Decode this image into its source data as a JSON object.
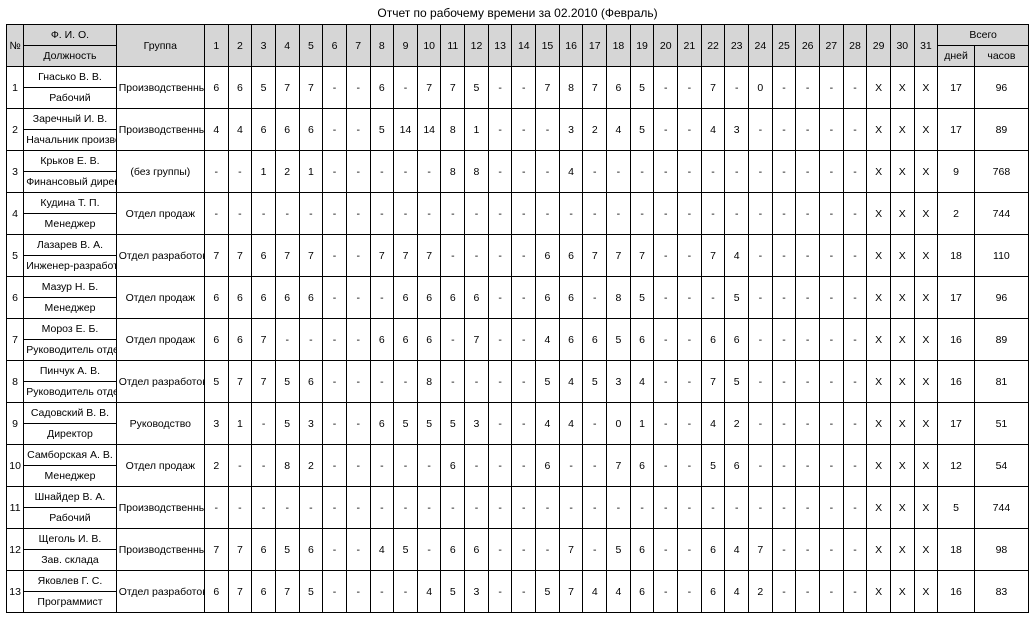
{
  "title": "Отчет по рабочему времени за 02.2010 (Февраль)",
  "headers": {
    "index": "№",
    "fio": "Ф. И. О.",
    "position": "Должность",
    "group": "Группа",
    "total": "Всего",
    "days_lbl": "дней",
    "hours_lbl": "часов"
  },
  "day_count": 31,
  "rows": [
    {
      "n": "1",
      "name": "Гнасько В. В.",
      "position": "Рабочий",
      "group": "Производственны",
      "cells": [
        "6",
        "6",
        "5",
        "7",
        "7",
        "-",
        "-",
        "6",
        "-",
        "7",
        "7",
        "5",
        "-",
        "-",
        "7",
        "8",
        "7",
        "6",
        "5",
        "-",
        "-",
        "7",
        "-",
        "0",
        "-",
        "-",
        "-",
        "-",
        "X",
        "X",
        "X"
      ],
      "days": "17",
      "hours": "96"
    },
    {
      "n": "2",
      "name": "Заречный И. В.",
      "position": "Начальник производства",
      "group": "Производственны",
      "cells": [
        "4",
        "4",
        "6",
        "6",
        "6",
        "-",
        "-",
        "5",
        "14",
        "14",
        "8",
        "1",
        "-",
        "-",
        "-",
        "3",
        "2",
        "4",
        "5",
        "-",
        "-",
        "4",
        "3",
        "-",
        "-",
        "-",
        "-",
        "-",
        "X",
        "X",
        "X"
      ],
      "days": "17",
      "hours": "89"
    },
    {
      "n": "3",
      "name": "Крьков Е. В.",
      "position": "Финансовый директор",
      "group": "(без группы)",
      "cells": [
        "-",
        "-",
        "1",
        "2",
        "1",
        "-",
        "-",
        "-",
        "-",
        "-",
        "8",
        "8",
        "-",
        "-",
        "-",
        "4",
        "-",
        "-",
        "-",
        "-",
        "-",
        "-",
        "-",
        "-",
        "-",
        "-",
        "-",
        "-",
        "X",
        "X",
        "X"
      ],
      "days": "9",
      "hours": "768"
    },
    {
      "n": "4",
      "name": "Кудина Т. П.",
      "position": "Менеджер",
      "group": "Отдел продаж",
      "cells": [
        "-",
        "-",
        "-",
        "-",
        "-",
        "-",
        "-",
        "-",
        "-",
        "-",
        "-",
        "-",
        "-",
        "-",
        "-",
        "-",
        "-",
        "-",
        "-",
        "-",
        "-",
        "-",
        "-",
        "-",
        "-",
        "-",
        "-",
        "-",
        "X",
        "X",
        "X"
      ],
      "days": "2",
      "hours": "744"
    },
    {
      "n": "5",
      "name": "Лазарев В. А.",
      "position": "Инженер-разработчик",
      "group": "Отдел разработок",
      "cells": [
        "7",
        "7",
        "6",
        "7",
        "7",
        "-",
        "-",
        "7",
        "7",
        "7",
        "-",
        "-",
        "-",
        "-",
        "6",
        "6",
        "7",
        "7",
        "7",
        "-",
        "-",
        "7",
        "4",
        "-",
        "-",
        "-",
        "-",
        "-",
        "X",
        "X",
        "X"
      ],
      "days": "18",
      "hours": "110"
    },
    {
      "n": "6",
      "name": "Мазур Н. Б.",
      "position": "Менеджер",
      "group": "Отдел продаж",
      "cells": [
        "6",
        "6",
        "6",
        "6",
        "6",
        "-",
        "-",
        "-",
        "6",
        "6",
        "6",
        "6",
        "-",
        "-",
        "6",
        "6",
        "-",
        "8",
        "5",
        "-",
        "-",
        "-",
        "5",
        "-",
        "-",
        "-",
        "-",
        "-",
        "X",
        "X",
        "X"
      ],
      "days": "17",
      "hours": "96"
    },
    {
      "n": "7",
      "name": "Мороз Е. Б.",
      "position": "Руководитель отдела продаж",
      "group": "Отдел продаж",
      "cells": [
        "6",
        "6",
        "7",
        "-",
        "-",
        "-",
        "-",
        "6",
        "6",
        "6",
        "-",
        "7",
        "-",
        "-",
        "4",
        "6",
        "6",
        "5",
        "6",
        "-",
        "-",
        "6",
        "6",
        "-",
        "-",
        "-",
        "-",
        "-",
        "X",
        "X",
        "X"
      ],
      "days": "16",
      "hours": "89"
    },
    {
      "n": "8",
      "name": "Пинчук А. В.",
      "position": "Руководитель отдела разработок",
      "group": "Отдел разработок",
      "cells": [
        "5",
        "7",
        "7",
        "5",
        "6",
        "-",
        "-",
        "-",
        "-",
        "8",
        "-",
        "-",
        "-",
        "-",
        "5",
        "4",
        "5",
        "3",
        "4",
        "-",
        "-",
        "7",
        "5",
        "-",
        "-",
        "-",
        "-",
        "-",
        "X",
        "X",
        "X"
      ],
      "days": "16",
      "hours": "81"
    },
    {
      "n": "9",
      "name": "Садовский В. В.",
      "position": "Директор",
      "group": "Руководство",
      "cells": [
        "3",
        "1",
        "-",
        "5",
        "3",
        "-",
        "-",
        "6",
        "5",
        "5",
        "5",
        "3",
        "-",
        "-",
        "4",
        "4",
        "-",
        "0",
        "1",
        "-",
        "-",
        "4",
        "2",
        "-",
        "-",
        "-",
        "-",
        "-",
        "X",
        "X",
        "X"
      ],
      "days": "17",
      "hours": "51"
    },
    {
      "n": "10",
      "name": "Самборская А. В.",
      "position": "Менеджер",
      "group": "Отдел продаж",
      "cells": [
        "2",
        "-",
        "-",
        "8",
        "2",
        "-",
        "-",
        "-",
        "-",
        "-",
        "6",
        "-",
        "-",
        "-",
        "6",
        "-",
        "-",
        "7",
        "6",
        "-",
        "-",
        "5",
        "6",
        "-",
        "-",
        "-",
        "-",
        "-",
        "X",
        "X",
        "X"
      ],
      "days": "12",
      "hours": "54"
    },
    {
      "n": "11",
      "name": "Шнайдер В. А.",
      "position": "Рабочий",
      "group": "Производственны",
      "cells": [
        "-",
        "-",
        "-",
        "-",
        "-",
        "-",
        "-",
        "-",
        "-",
        "-",
        "-",
        "-",
        "-",
        "-",
        "-",
        "-",
        "-",
        "-",
        "-",
        "-",
        "-",
        "-",
        "-",
        "-",
        "-",
        "-",
        "-",
        "-",
        "X",
        "X",
        "X"
      ],
      "days": "5",
      "hours": "744"
    },
    {
      "n": "12",
      "name": "Щеголь И. В.",
      "position": "Зав. склада",
      "group": "Производственны",
      "cells": [
        "7",
        "7",
        "6",
        "5",
        "6",
        "-",
        "-",
        "4",
        "5",
        "-",
        "6",
        "6",
        "-",
        "-",
        "-",
        "7",
        "-",
        "5",
        "6",
        "-",
        "-",
        "6",
        "4",
        "7",
        "-",
        "-",
        "-",
        "-",
        "X",
        "X",
        "X"
      ],
      "days": "18",
      "hours": "98"
    },
    {
      "n": "13",
      "name": "Яковлев Г. С.",
      "position": "Программист",
      "group": "Отдел разработок",
      "cells": [
        "6",
        "7",
        "6",
        "7",
        "5",
        "-",
        "-",
        "-",
        "-",
        "4",
        "5",
        "3",
        "-",
        "-",
        "5",
        "7",
        "4",
        "4",
        "6",
        "-",
        "-",
        "6",
        "4",
        "2",
        "-",
        "-",
        "-",
        "-",
        "X",
        "X",
        "X"
      ],
      "days": "16",
      "hours": "83"
    }
  ]
}
